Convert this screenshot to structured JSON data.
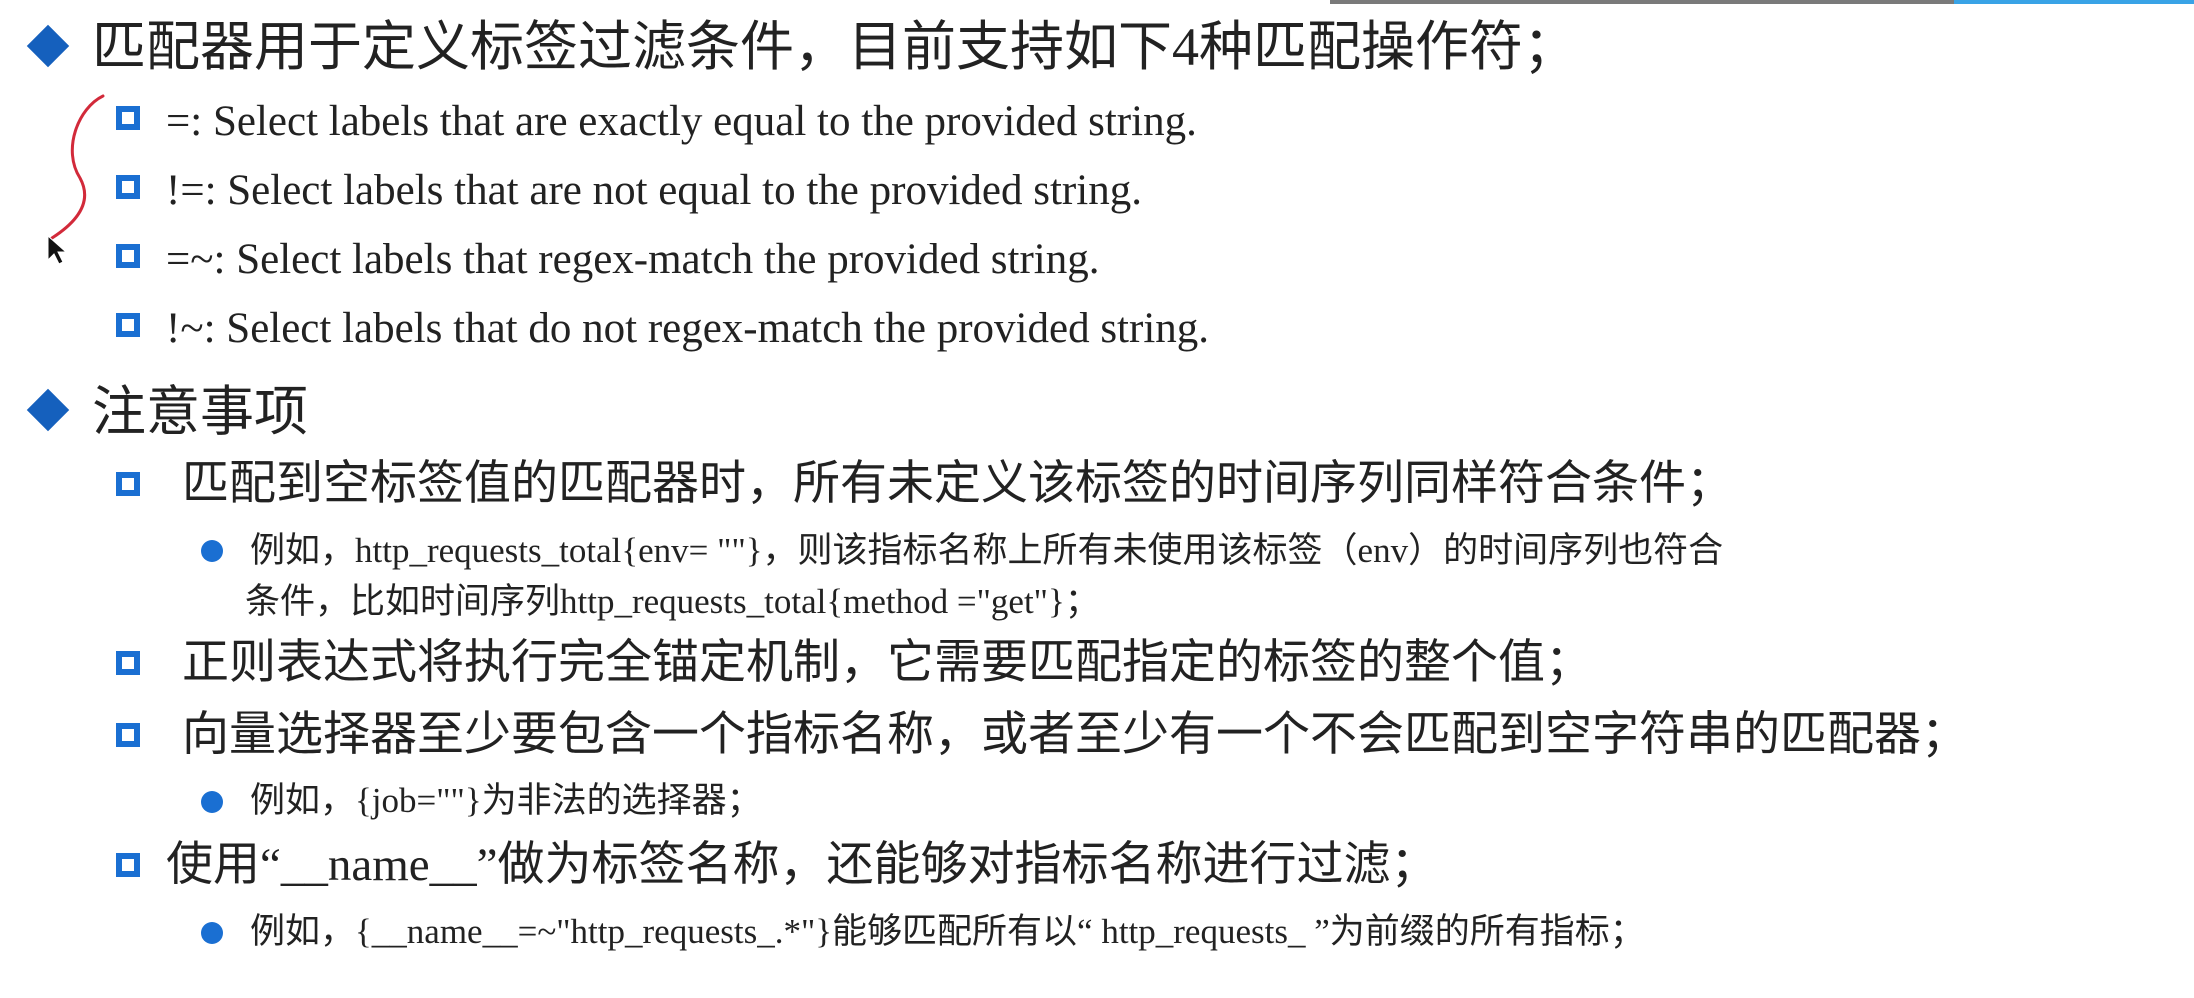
{
  "section1": {
    "heading": "匹配器用于定义标签过滤条件，目前支持如下4种匹配操作符；",
    "items": [
      "=: Select labels that are exactly equal to the provided string.",
      "!=: Select labels that are not equal to the provided string.",
      "=~: Select labels that regex-match the provided string.",
      "!~: Select labels that do not regex-match the provided string."
    ]
  },
  "section2": {
    "heading": "注意事项",
    "item1": "匹配到空标签值的匹配器时，所有未定义该标签的时间序列同样符合条件；",
    "item1_example_line1": "例如，http_requests_total{env= \"\"}，则该指标名称上所有未使用该标签（env）的时间序列也符合",
    "item1_example_line2": "条件，比如时间序列http_requests_total{method =\"get\"}；",
    "item2": "正则表达式将执行完全锚定机制，它需要匹配指定的标签的整个值；",
    "item3": "向量选择器至少要包含一个指标名称，或者至少有一个不会匹配到空字符串的匹配器；",
    "item3_example": "例如，{job=\"\"}为非法的选择器；",
    "item4": "使用“__name__”做为标签名称，还能够对指标名称进行过滤；",
    "item4_example": "例如，{__name__=~\"http_requests_.*\"}能够匹配所有以“ http_requests_ ”为前缀的所有指标；"
  },
  "colors": {
    "bullet_blue": "#1a6fd2",
    "annotation_red": "#d22a3a"
  }
}
